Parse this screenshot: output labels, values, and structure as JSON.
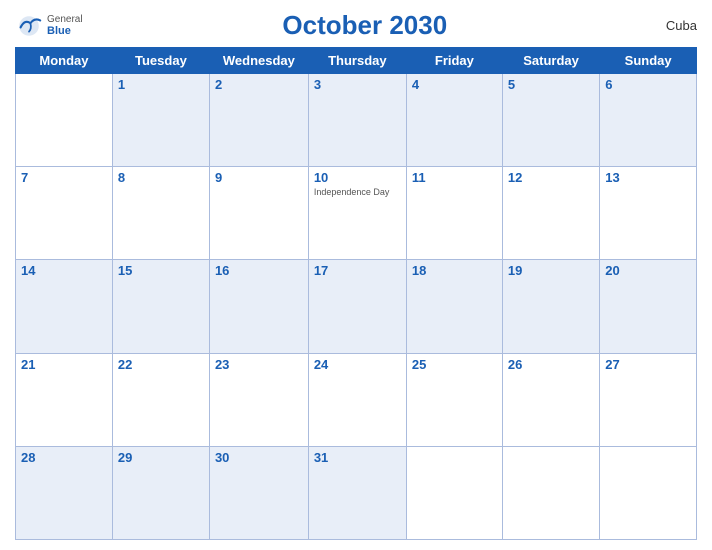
{
  "header": {
    "title": "October 2030",
    "country": "Cuba",
    "logo_general": "General",
    "logo_blue": "Blue"
  },
  "days_of_week": [
    "Monday",
    "Tuesday",
    "Wednesday",
    "Thursday",
    "Friday",
    "Saturday",
    "Sunday"
  ],
  "weeks": [
    [
      {
        "day": "",
        "empty": true
      },
      {
        "day": "1"
      },
      {
        "day": "2"
      },
      {
        "day": "3"
      },
      {
        "day": "4"
      },
      {
        "day": "5"
      },
      {
        "day": "6"
      }
    ],
    [
      {
        "day": "7"
      },
      {
        "day": "8"
      },
      {
        "day": "9"
      },
      {
        "day": "10",
        "holiday": "Independence Day"
      },
      {
        "day": "11"
      },
      {
        "day": "12"
      },
      {
        "day": "13"
      }
    ],
    [
      {
        "day": "14"
      },
      {
        "day": "15"
      },
      {
        "day": "16"
      },
      {
        "day": "17"
      },
      {
        "day": "18"
      },
      {
        "day": "19"
      },
      {
        "day": "20"
      }
    ],
    [
      {
        "day": "21"
      },
      {
        "day": "22"
      },
      {
        "day": "23"
      },
      {
        "day": "24"
      },
      {
        "day": "25"
      },
      {
        "day": "26"
      },
      {
        "day": "27"
      }
    ],
    [
      {
        "day": "28"
      },
      {
        "day": "29"
      },
      {
        "day": "30"
      },
      {
        "day": "31"
      },
      {
        "day": "",
        "empty": true
      },
      {
        "day": "",
        "empty": true
      },
      {
        "day": "",
        "empty": true
      }
    ]
  ]
}
